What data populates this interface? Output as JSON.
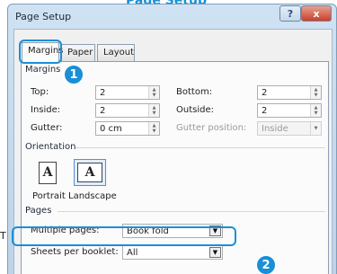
{
  "header_caption": "Page Setup",
  "side_letter": "T",
  "window": {
    "title": "Page Setup",
    "help_label": "?",
    "close_label": "x"
  },
  "tabs": [
    {
      "label": "Margins",
      "active": true
    },
    {
      "label": "Paper",
      "active": false
    },
    {
      "label": "Layout",
      "active": false
    }
  ],
  "callouts": {
    "one": "1",
    "two": "2"
  },
  "margins": {
    "section_label": "Margins",
    "top": {
      "label": "Top:",
      "value": "2"
    },
    "bottom": {
      "label": "Bottom:",
      "value": "2"
    },
    "inside": {
      "label": "Inside:",
      "value": "2"
    },
    "outside": {
      "label": "Outside:",
      "value": "2"
    },
    "gutter": {
      "label": "Gutter:",
      "value": "0 cm"
    },
    "gutter_position": {
      "label": "Gutter position:",
      "value": "Inside"
    }
  },
  "orientation": {
    "section_label": "Orientation",
    "portrait": {
      "label": "Portrait",
      "glyph": "A"
    },
    "landscape": {
      "label": "Landscape",
      "glyph": "A"
    }
  },
  "pages": {
    "section_label": "Pages",
    "multiple_pages": {
      "label": "Multiple pages:",
      "value": "Book fold"
    },
    "sheets_per_booklet": {
      "label": "Sheets per booklet:",
      "value": "All"
    }
  },
  "colors": {
    "callout_accent": "#1a8fd6"
  }
}
